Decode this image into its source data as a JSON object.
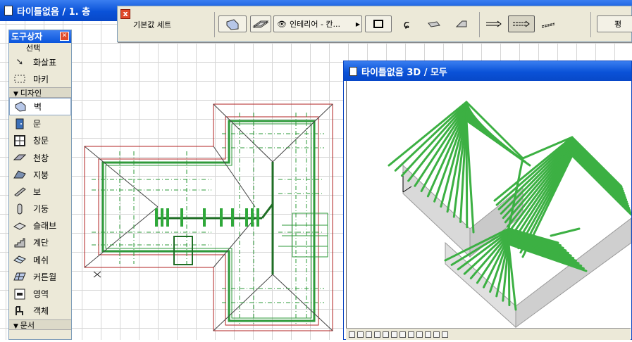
{
  "plan_window": {
    "title": "타이틀없음 / 1. 층"
  },
  "infobox": {
    "label": "기본값 세트",
    "interior_dropdown": "인테리어 - 칸...",
    "right_button": "평"
  },
  "toolbox": {
    "title": "도구상자",
    "sections": {
      "select": "선택",
      "design": "디자인",
      "document": "문서"
    },
    "select_tools": [
      {
        "name": "arrow",
        "label": "화살표",
        "icon": "arrow-icon"
      },
      {
        "name": "marquee",
        "label": "마키",
        "icon": "marquee-icon"
      }
    ],
    "design_tools": [
      {
        "name": "wall",
        "label": "벽",
        "icon": "wall-icon"
      },
      {
        "name": "door",
        "label": "문",
        "icon": "door-icon"
      },
      {
        "name": "window",
        "label": "창문",
        "icon": "window-icon"
      },
      {
        "name": "ceiling",
        "label": "천창",
        "icon": "skylight-icon"
      },
      {
        "name": "roof",
        "label": "지붕",
        "icon": "roof-icon"
      },
      {
        "name": "beam",
        "label": "보",
        "icon": "beam-icon"
      },
      {
        "name": "column",
        "label": "기둥",
        "icon": "column-icon"
      },
      {
        "name": "slab",
        "label": "슬래브",
        "icon": "slab-icon"
      },
      {
        "name": "stair",
        "label": "계단",
        "icon": "stair-icon"
      },
      {
        "name": "mesh",
        "label": "메쉬",
        "icon": "mesh-icon"
      },
      {
        "name": "curtainwall",
        "label": "커튼월",
        "icon": "curtainwall-icon"
      },
      {
        "name": "zone",
        "label": "영역",
        "icon": "zone-icon"
      },
      {
        "name": "object",
        "label": "객체",
        "icon": "object-icon"
      }
    ]
  },
  "window_3d": {
    "title": "타이틀없음 3D / 모두"
  },
  "colors": {
    "titlebar": "#0a52d8",
    "rafter": "#3cb043",
    "wall_red": "#b22222"
  }
}
